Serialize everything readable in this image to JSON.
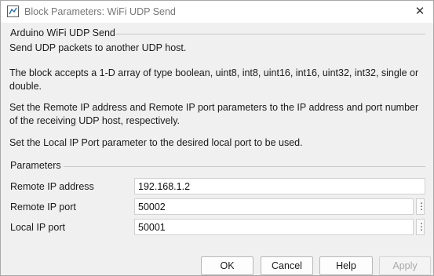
{
  "window": {
    "title": "Block Parameters: WiFi UDP Send",
    "close_symbol": "✕"
  },
  "block": {
    "group_title": "Arduino WiFi UDP Send",
    "descriptions": [
      "Send UDP packets to another UDP host.",
      "The block accepts a 1-D array of type boolean, uint8, int8, uint16, int16, uint32, int32, single or double.",
      "Set the Remote IP address and Remote IP port parameters to the IP address and port number of the receiving UDP host, respectively.",
      "Set the Local IP Port parameter to the desired local port to be used."
    ]
  },
  "parameters": {
    "group_title": "Parameters",
    "fields": [
      {
        "label": "Remote IP address",
        "value": "192.168.1.2"
      },
      {
        "label": "Remote IP port",
        "value": "50002",
        "menu_symbol": "⋮"
      },
      {
        "label": "Local IP port",
        "value": "50001",
        "menu_symbol": "⋮"
      }
    ]
  },
  "buttons": {
    "ok": "OK",
    "cancel": "Cancel",
    "help": "Help",
    "apply": "Apply"
  }
}
